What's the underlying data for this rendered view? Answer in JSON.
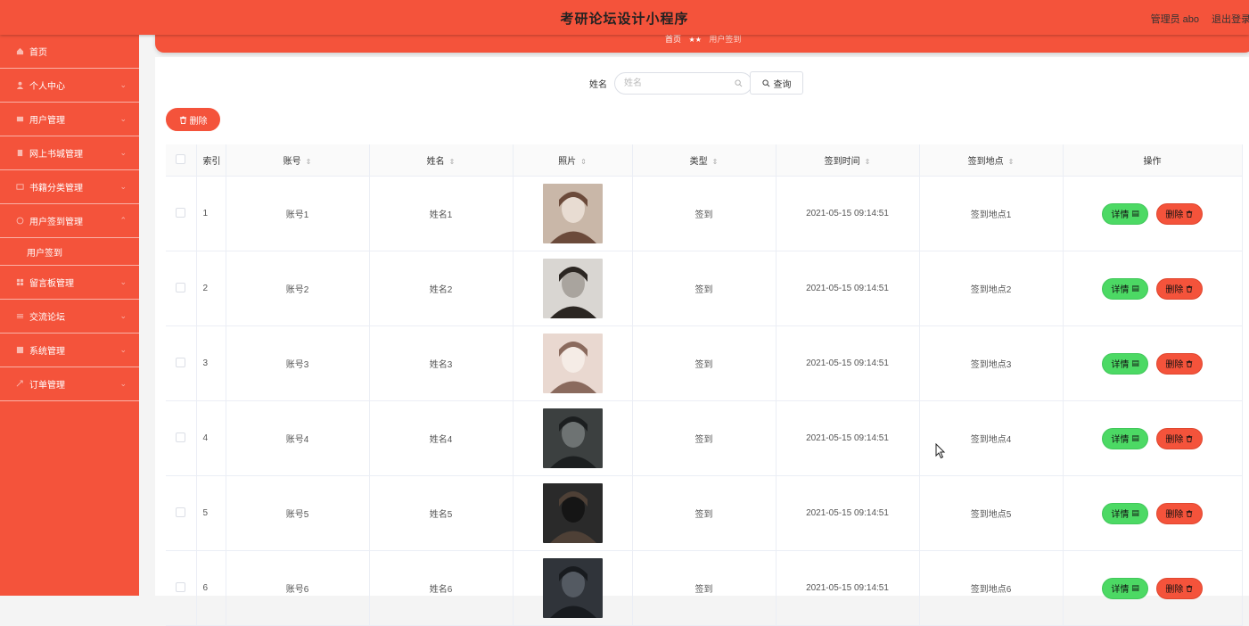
{
  "header": {
    "title": "考研论坛设计小程序",
    "user_role": "管理员 abo",
    "logout": "退出登录"
  },
  "sidebar": {
    "items": [
      {
        "label": "首页",
        "icon": "home-icon"
      },
      {
        "label": "个人中心",
        "icon": "user-icon"
      },
      {
        "label": "用户管理",
        "icon": "user-group-icon"
      },
      {
        "label": "网上书城管理",
        "icon": "book-icon"
      },
      {
        "label": "书籍分类管理",
        "icon": "category-icon"
      },
      {
        "label": "用户签到管理",
        "icon": "checkin-icon"
      },
      {
        "label": "用户签到",
        "sub": true
      },
      {
        "label": "留言板管理",
        "icon": "grid-icon"
      },
      {
        "label": "交流论坛",
        "icon": "forum-icon"
      },
      {
        "label": "系统管理",
        "icon": "system-icon"
      },
      {
        "label": "订单管理",
        "icon": "order-icon"
      }
    ]
  },
  "breadcrumb": {
    "home": "首页",
    "sep": "★★",
    "current": "用户签到"
  },
  "search": {
    "label": "姓名",
    "placeholder": "姓名",
    "button": "查询"
  },
  "toolbar": {
    "delete_label": "删除"
  },
  "table": {
    "headers": [
      "索引",
      "账号",
      "姓名",
      "照片",
      "类型",
      "签到时间",
      "签到地点",
      "操作"
    ],
    "rows": [
      {
        "index": "1",
        "account": "账号1",
        "name": "姓名1",
        "type": "签到",
        "time": "2021-05-15 09:14:51",
        "place": "签到地点1"
      },
      {
        "index": "2",
        "account": "账号2",
        "name": "姓名2",
        "type": "签到",
        "time": "2021-05-15 09:14:51",
        "place": "签到地点2"
      },
      {
        "index": "3",
        "account": "账号3",
        "name": "姓名3",
        "type": "签到",
        "time": "2021-05-15 09:14:51",
        "place": "签到地点3"
      },
      {
        "index": "4",
        "account": "账号4",
        "name": "姓名4",
        "type": "签到",
        "time": "2021-05-15 09:14:51",
        "place": "签到地点4"
      },
      {
        "index": "5",
        "account": "账号5",
        "name": "姓名5",
        "type": "签到",
        "time": "2021-05-15 09:14:51",
        "place": "签到地点5"
      },
      {
        "index": "6",
        "account": "账号6",
        "name": "姓名6",
        "type": "签到",
        "time": "2021-05-15 09:14:51",
        "place": "签到地点6"
      }
    ],
    "detail_label": "详情",
    "delete_label": "删除"
  },
  "colors": {
    "accent": "#f4533b",
    "success": "#4cd964"
  }
}
